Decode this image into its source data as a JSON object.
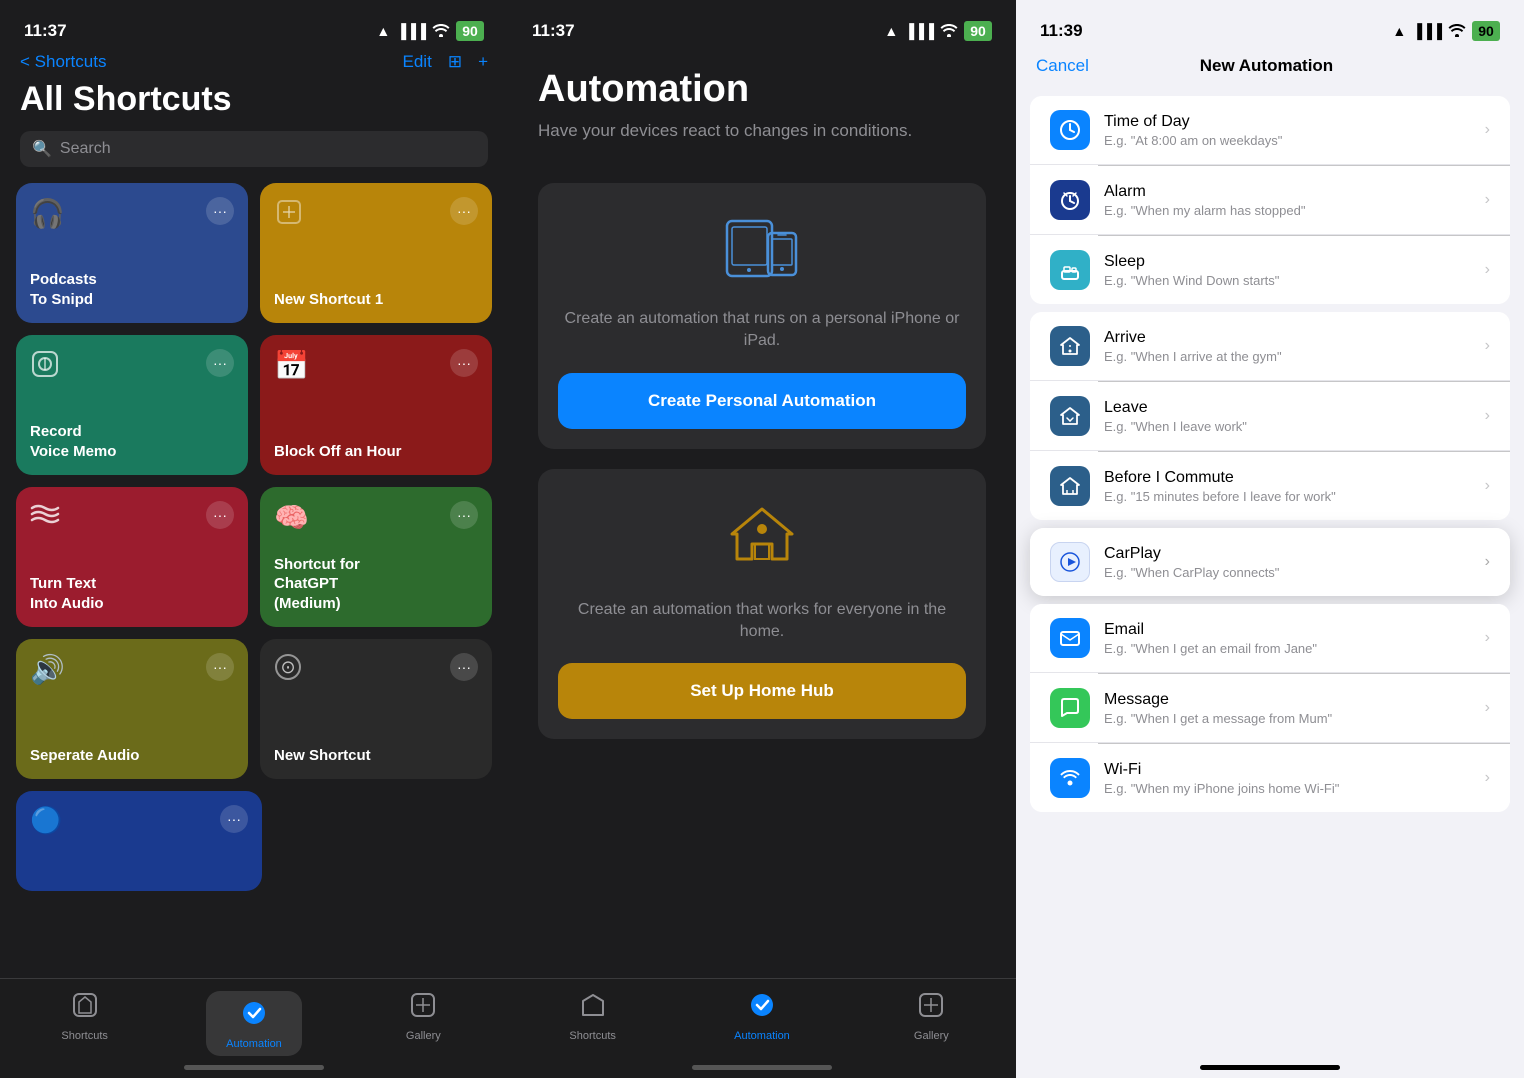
{
  "panel1": {
    "statusBar": {
      "time": "11:37",
      "location": "▲",
      "signal": "▐▐▐▐",
      "wifi": "wifi",
      "battery": "90"
    },
    "navBack": "< Shortcuts",
    "navEdit": "Edit",
    "navGrid": "⊞",
    "navAdd": "+",
    "pageTitle": "All Shortcuts",
    "searchPlaceholder": "Search",
    "shortcuts": [
      {
        "id": "podcasts",
        "icon": "🎧",
        "label": "Podcasts\nTo Snipd",
        "bg": "bg-navy"
      },
      {
        "id": "new1",
        "icon": "⬡",
        "label": "New Shortcut 1",
        "bg": "bg-gold"
      },
      {
        "id": "voice",
        "icon": "⬡",
        "label": "Record\nVoice Memo",
        "bg": "bg-teal"
      },
      {
        "id": "block",
        "icon": "📅",
        "label": "Block Off an Hour",
        "bg": "bg-red"
      },
      {
        "id": "text-audio",
        "icon": "〰",
        "label": "Turn Text\nInto Audio",
        "bg": "bg-crimson"
      },
      {
        "id": "chatgpt",
        "icon": "🧠",
        "label": "Shortcut for\nChatGPT\n(Medium)",
        "bg": "bg-green"
      },
      {
        "id": "audio",
        "icon": "🔊",
        "label": "Seperate Audio",
        "bg": "bg-olive"
      },
      {
        "id": "new2",
        "icon": "⊙",
        "label": "New Shortcut",
        "bg": "bg-dark"
      },
      {
        "id": "partial1",
        "icon": "🔵",
        "label": "",
        "bg": "bg-blue-dark"
      }
    ],
    "tabs": [
      {
        "id": "shortcuts",
        "icon": "⬡",
        "label": "Shortcuts",
        "active": false
      },
      {
        "id": "automation",
        "icon": "✓",
        "label": "Automation",
        "active": true
      },
      {
        "id": "gallery",
        "icon": "+",
        "label": "Gallery",
        "active": false
      }
    ]
  },
  "panel2": {
    "statusBar": {
      "time": "11:37",
      "battery": "90"
    },
    "title": "Automation",
    "subtitle": "Have your devices react to changes in conditions.",
    "personalCard": {
      "description": "Create an automation that runs on a personal iPhone or iPad.",
      "buttonLabel": "Create Personal Automation"
    },
    "homeCard": {
      "description": "Create an automation that works for everyone in the home.",
      "buttonLabel": "Set Up Home Hub"
    },
    "tabs": [
      {
        "id": "shortcuts",
        "label": "Shortcuts",
        "active": false
      },
      {
        "id": "automation",
        "label": "Automation",
        "active": true
      },
      {
        "id": "gallery",
        "label": "Gallery",
        "active": false
      }
    ]
  },
  "panel3": {
    "statusBar": {
      "time": "11:39",
      "battery": "90"
    },
    "navCancel": "Cancel",
    "navTitle": "New Automation",
    "items": [
      {
        "id": "time-of-day",
        "icon": "🕐",
        "iconBg": "icon-blue",
        "title": "Time of Day",
        "subtitle": "E.g. \"At 8:00 am on weekdays\""
      },
      {
        "id": "alarm",
        "icon": "⏰",
        "iconBg": "icon-dark-blue",
        "title": "Alarm",
        "subtitle": "E.g. \"When my alarm has stopped\""
      },
      {
        "id": "sleep",
        "icon": "🛏",
        "iconBg": "icon-teal",
        "title": "Sleep",
        "subtitle": "E.g. \"When Wind Down starts\""
      },
      {
        "id": "arrive",
        "icon": "🏠",
        "iconBg": "icon-house",
        "title": "Arrive",
        "subtitle": "E.g. \"When I arrive at the gym\""
      },
      {
        "id": "leave",
        "icon": "🏠",
        "iconBg": "icon-house",
        "title": "Leave",
        "subtitle": "E.g. \"When I leave work\""
      },
      {
        "id": "before-commute",
        "icon": "🚶",
        "iconBg": "icon-house",
        "title": "Before I Commute",
        "subtitle": "E.g. \"15 minutes before I leave for work\""
      },
      {
        "id": "carplay",
        "icon": "▶",
        "iconBg": "icon-carplay",
        "title": "CarPlay",
        "subtitle": "E.g. \"When CarPlay connects\"",
        "highlighted": true
      },
      {
        "id": "email",
        "icon": "✉",
        "iconBg": "icon-mail",
        "title": "Email",
        "subtitle": "E.g. \"When I get an email from Jane\""
      },
      {
        "id": "message",
        "icon": "💬",
        "iconBg": "icon-message",
        "title": "Message",
        "subtitle": "E.g. \"When I get a message from Mum\""
      },
      {
        "id": "wifi",
        "icon": "📶",
        "iconBg": "icon-wifi",
        "title": "Wi-Fi",
        "subtitle": "E.g. \"When my iPhone joins home Wi-Fi\""
      }
    ]
  }
}
